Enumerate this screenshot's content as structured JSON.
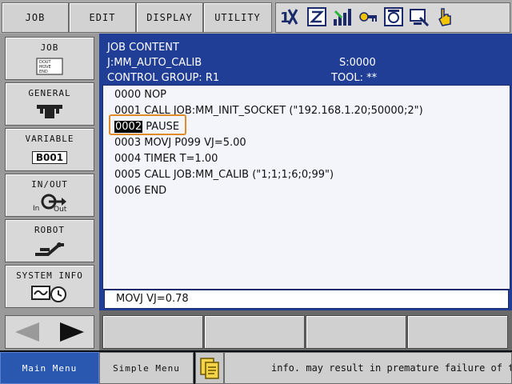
{
  "top_menu": {
    "job": "JOB",
    "edit": "EDIT",
    "display": "DISPLAY",
    "utility": "UTILITY"
  },
  "status_icons": [
    "axis-tool-icon",
    "edit-mode-icon",
    "signal-strength-icon",
    "key-icon",
    "teach-pendant-icon",
    "monitor-icon",
    "hand-pointer-icon"
  ],
  "left_menu": {
    "items": [
      {
        "label": "JOB",
        "sub": [
          "DOUT",
          "MOVE",
          "END"
        ]
      },
      {
        "label": "GENERAL"
      },
      {
        "label": "VARIABLE",
        "badge": "B001"
      },
      {
        "label": "IN/OUT",
        "in": "In",
        "out": "Out"
      },
      {
        "label": "ROBOT"
      },
      {
        "label": "SYSTEM INFO"
      }
    ]
  },
  "job_content": {
    "title": "JOB CONTENT",
    "job_name": "J:MM_AUTO_CALIB",
    "step": "S:0000",
    "control_group": "CONTROL GROUP: R1",
    "tool": "TOOL: **",
    "lines": [
      {
        "num": "0000",
        "text": " NOP"
      },
      {
        "num": "0001",
        "text": " CALL JOB:MM_INIT_SOCKET (\"192.168.1.20;50000;2\")"
      },
      {
        "num": "0002",
        "text": " PAUSE"
      },
      {
        "num": "0003",
        "text": " MOVJ P099 VJ=5.00"
      },
      {
        "num": "0004",
        "text": " TIMER T=1.00"
      },
      {
        "num": "0005",
        "text": " CALL JOB:MM_CALIB (\"1;1;1;6;0;99\")"
      },
      {
        "num": "0006",
        "text": " END"
      }
    ],
    "edit_buffer": "MOVJ VJ=0.78"
  },
  "bottom": {
    "main_menu": "Main Menu",
    "simple_menu": "Simple Menu",
    "message": "info. may result in premature failure of tl"
  },
  "colors": {
    "panel_blue": "#213e96",
    "highlight_orange": "#e08a2a",
    "main_menu_blue": "#2a57b0"
  }
}
